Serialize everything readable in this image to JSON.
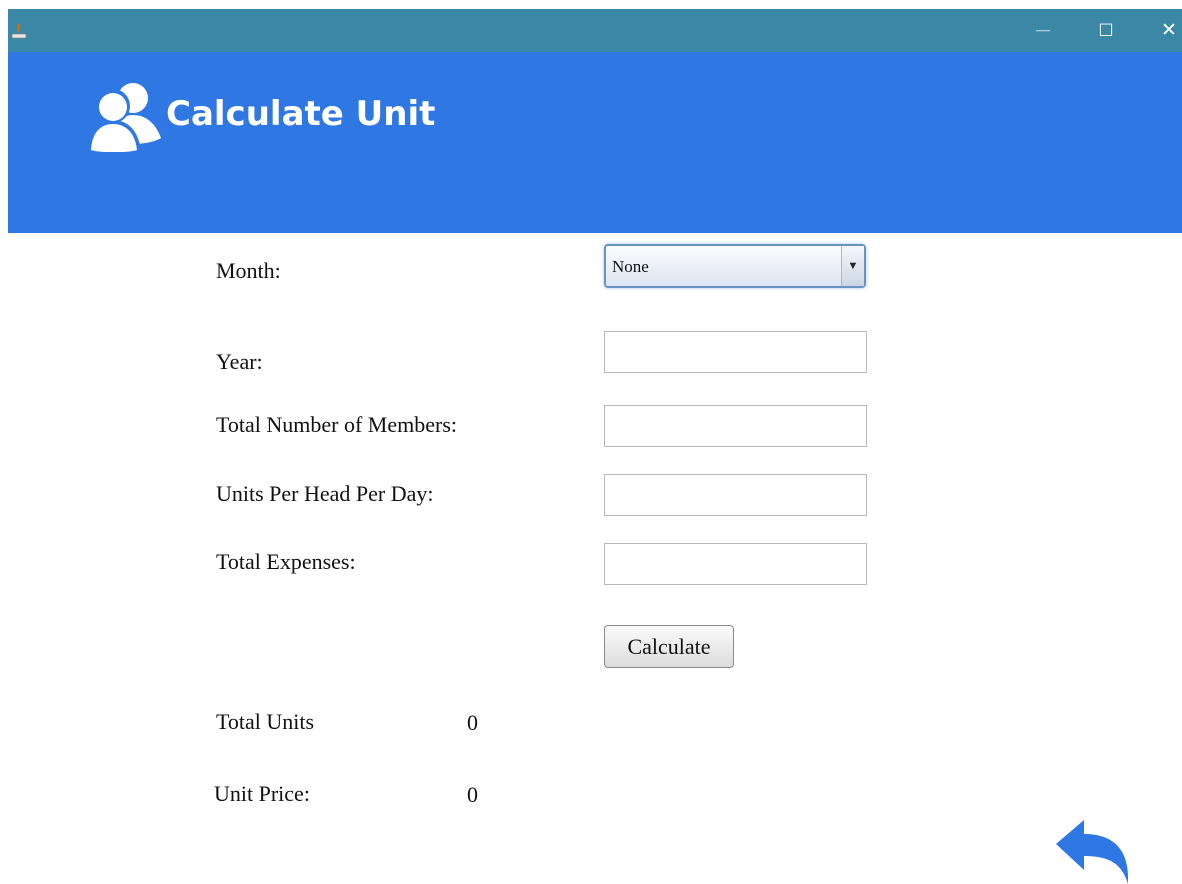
{
  "window": {
    "minimize_glyph": "—",
    "maximize_glyph": "☐",
    "close_glyph": "✕",
    "app_icon": "java-icon"
  },
  "header": {
    "title": "Calculate Unit",
    "icon": "users-icon",
    "background": "#2f78e4"
  },
  "form": {
    "month_label": "Month:",
    "month_selected": "None",
    "year_label": "Year:",
    "year_value": "",
    "members_label": "Total Number of Members:",
    "members_value": "",
    "units_per_head_label": "Units Per Head Per Day:",
    "units_per_head_value": "",
    "expenses_label": "Total Expenses:",
    "expenses_value": "",
    "calculate_label": "Calculate"
  },
  "results": {
    "total_units_label": "Total Units",
    "total_units_value": "0",
    "unit_price_label": "Unit Price:",
    "unit_price_value": "0"
  },
  "footer": {
    "back_icon": "back-arrow-icon",
    "accent": "#2f78e4"
  }
}
